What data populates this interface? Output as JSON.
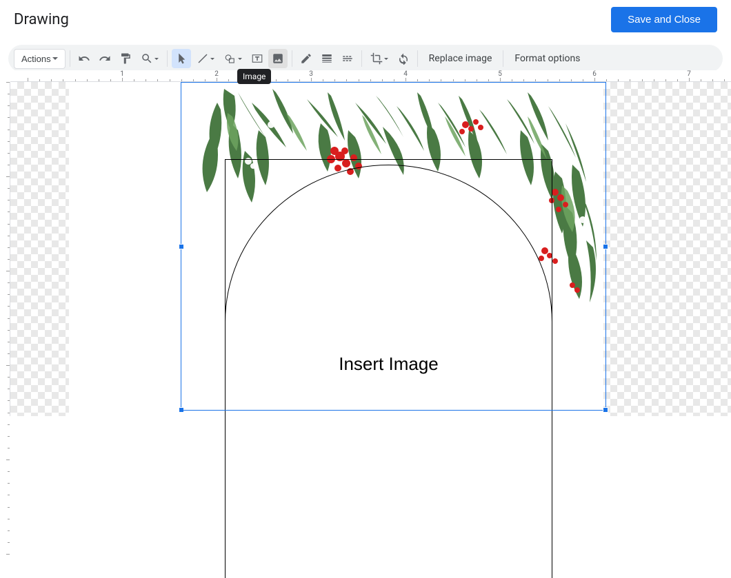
{
  "header": {
    "title": "Drawing",
    "save_button": "Save and Close"
  },
  "toolbar": {
    "actions": "Actions",
    "replace_image": "Replace image",
    "format_options": "Format options"
  },
  "tooltip": {
    "image": "Image"
  },
  "canvas": {
    "center_text": "Insert Image"
  },
  "ruler": {
    "marks": [
      "1",
      "2",
      "3",
      "4",
      "5",
      "6",
      "7"
    ]
  },
  "colors": {
    "primary": "#1a73e8",
    "leaf_dark": "#3e6b3a",
    "leaf_mid": "#5a8a4f",
    "flower": "#d81e1e"
  }
}
